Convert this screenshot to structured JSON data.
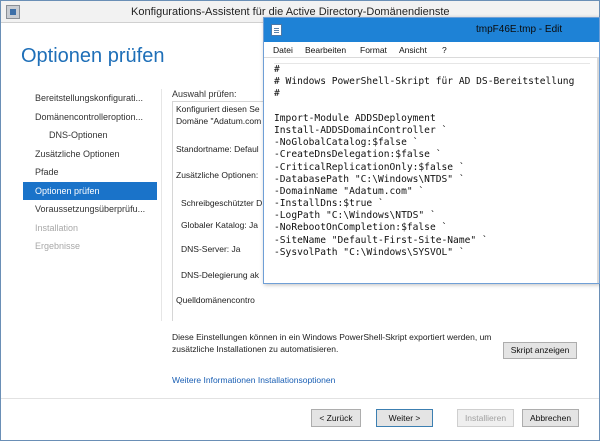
{
  "wizard": {
    "title": "Konfigurations-Assistent für die Active Directory-Domänendienste",
    "page_header": "Optionen prüfen",
    "nav": [
      {
        "label": "Bereitstellungskonfigurati...",
        "state": "normal",
        "level": 0
      },
      {
        "label": "Domänencontrolleroption...",
        "state": "normal",
        "level": 0
      },
      {
        "label": "DNS-Optionen",
        "state": "normal",
        "level": 1
      },
      {
        "label": "Zusätzliche Optionen",
        "state": "normal",
        "level": 0
      },
      {
        "label": "Pfade",
        "state": "normal",
        "level": 0
      },
      {
        "label": "Optionen prüfen",
        "state": "active",
        "level": 0
      },
      {
        "label": "Voraussetzungsüberprüfu...",
        "state": "normal",
        "level": 0
      },
      {
        "label": "Installation",
        "state": "disabled",
        "level": 0
      },
      {
        "label": "Ergebnisse",
        "state": "disabled",
        "level": 0
      }
    ],
    "review": {
      "label": "Auswahl prüfen:",
      "lines": [
        {
          "text": "Konfiguriert diesen Se",
          "indent": false
        },
        {
          "text": "Domäne \"Adatum.com",
          "indent": false
        },
        {
          "text": "Standortname: Defaul",
          "indent": false
        },
        {
          "text": "Zusätzliche Optionen:",
          "indent": false
        },
        {
          "text": "Schreibgeschützter D",
          "indent": true
        },
        {
          "text": "Globaler Katalog: Ja",
          "indent": true
        },
        {
          "text": "DNS-Server: Ja",
          "indent": true
        },
        {
          "text": "DNS-Delegierung ak",
          "indent": true
        },
        {
          "text": "Quelldomänencontro",
          "indent": false
        }
      ]
    },
    "footer_text": "Diese Einstellungen können in ein Windows PowerShell-Skript exportiert werden, um zusätzliche Installationen zu automatisieren.",
    "script_button": "Skript anzeigen",
    "more_link": "Weitere Informationen Installationsoptionen",
    "buttons": {
      "back": "< Zurück",
      "next": "Weiter >",
      "install": "Installieren",
      "cancel": "Abbrechen"
    }
  },
  "notepad": {
    "title": "tmpF46E.tmp - Edit",
    "menu": [
      "Datei",
      "Bearbeiten",
      "Format",
      "Ansicht",
      "?"
    ],
    "lines": [
      "#",
      "# Windows PowerShell-Skript für AD DS-Bereitstellung",
      "#",
      "",
      "Import-Module ADDSDeployment",
      "Install-ADDSDomainController `",
      "-NoGlobalCatalog:$false `",
      "-CreateDnsDelegation:$false `",
      "-CriticalReplicationOnly:$false `",
      "-DatabasePath \"C:\\Windows\\NTDS\" `",
      "-DomainName \"Adatum.com\" `",
      "-InstallDns:$true `",
      "-LogPath \"C:\\Windows\\NTDS\" `",
      "-NoRebootOnCompletion:$false `",
      "-SiteName \"Default-First-Site-Name\" `",
      "-SysvolPath \"C:\\Windows\\SYSVOL\" `"
    ]
  }
}
